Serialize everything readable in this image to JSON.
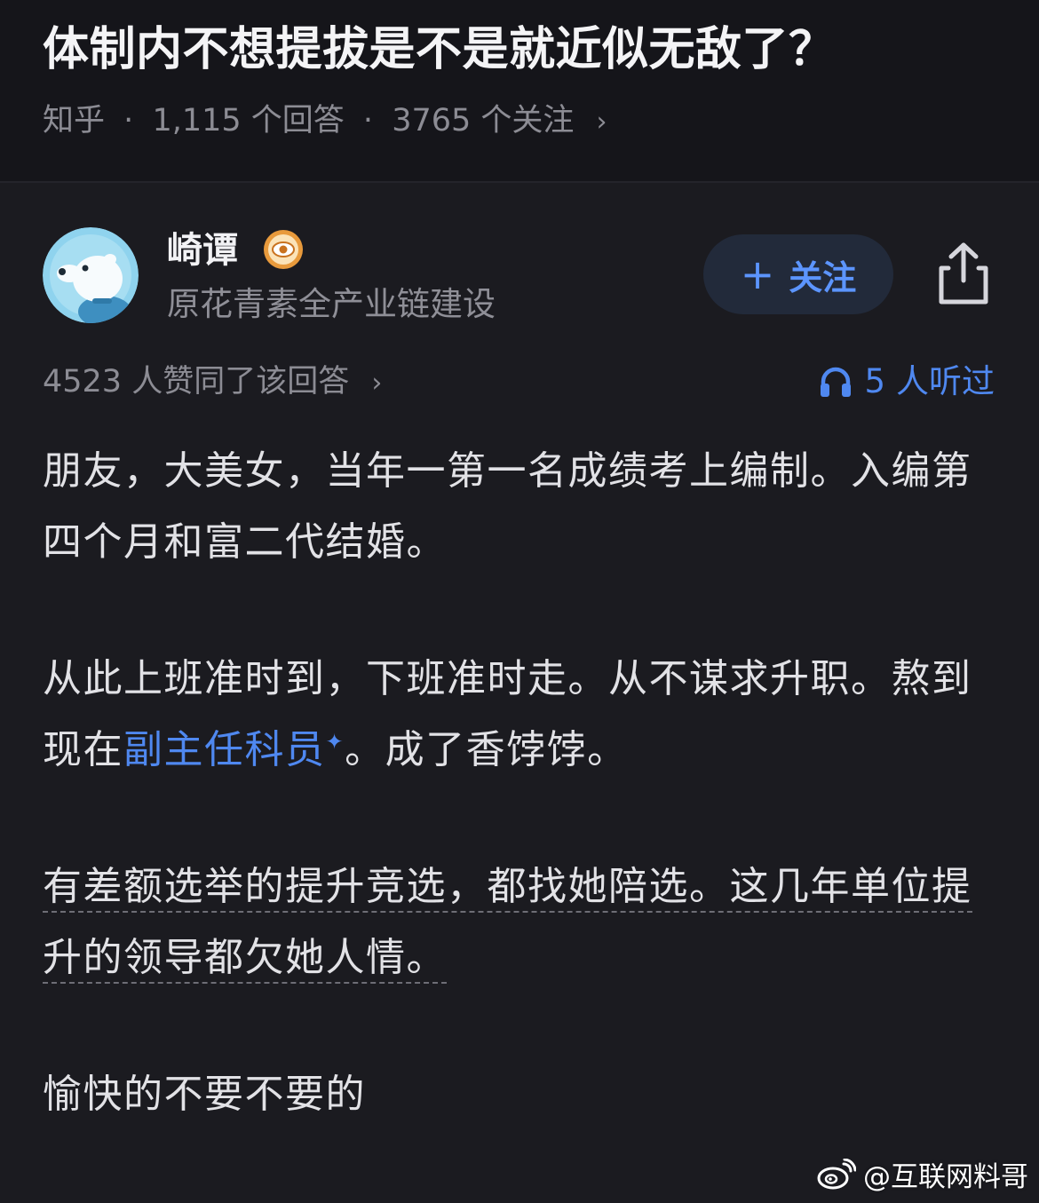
{
  "question": {
    "title": "体制内不想提拔是不是就近似无敌了？",
    "source": "知乎",
    "separator": "·",
    "answers_count": "1,115 个回答",
    "followers_count": "3765 个关注",
    "chevron": "›"
  },
  "author": {
    "name": "崎谭",
    "bio": "原花青素全产业链建设",
    "avatar_icon": "polar-bear-avatar-icon",
    "badge_icon": "eye-badge-icon"
  },
  "actions": {
    "follow_plus": "+",
    "follow_label": "关注",
    "share_icon": "share-icon"
  },
  "stats": {
    "upvotes_text": "4523 人赞同了该回答",
    "chevron": "›",
    "listen_count": "5",
    "listen_suffix": "人听过",
    "listen_icon": "headphones-icon"
  },
  "content": {
    "p1": "朋友，大美女，当年一第一名成绩考上编制。入编第四个月和富二代结婚。",
    "p2_a": "从此上班准时到，下班准时走。从不谋求升职。熬到现在",
    "p2_link": "副主任科员",
    "p2_spark": "✦",
    "p2_b": "。成了香饽饽。",
    "p3": "有差额选举的提升竞选，都找她陪选。这几年单位提升的领导都欠她人情。",
    "p4": "愉快的不要不要的"
  },
  "watermark": {
    "text": "@互联网料哥",
    "icon": "weibo-icon"
  },
  "colors": {
    "background": "#1b1b20",
    "accent": "#4f88f0",
    "follow_bg": "#222a3a"
  }
}
